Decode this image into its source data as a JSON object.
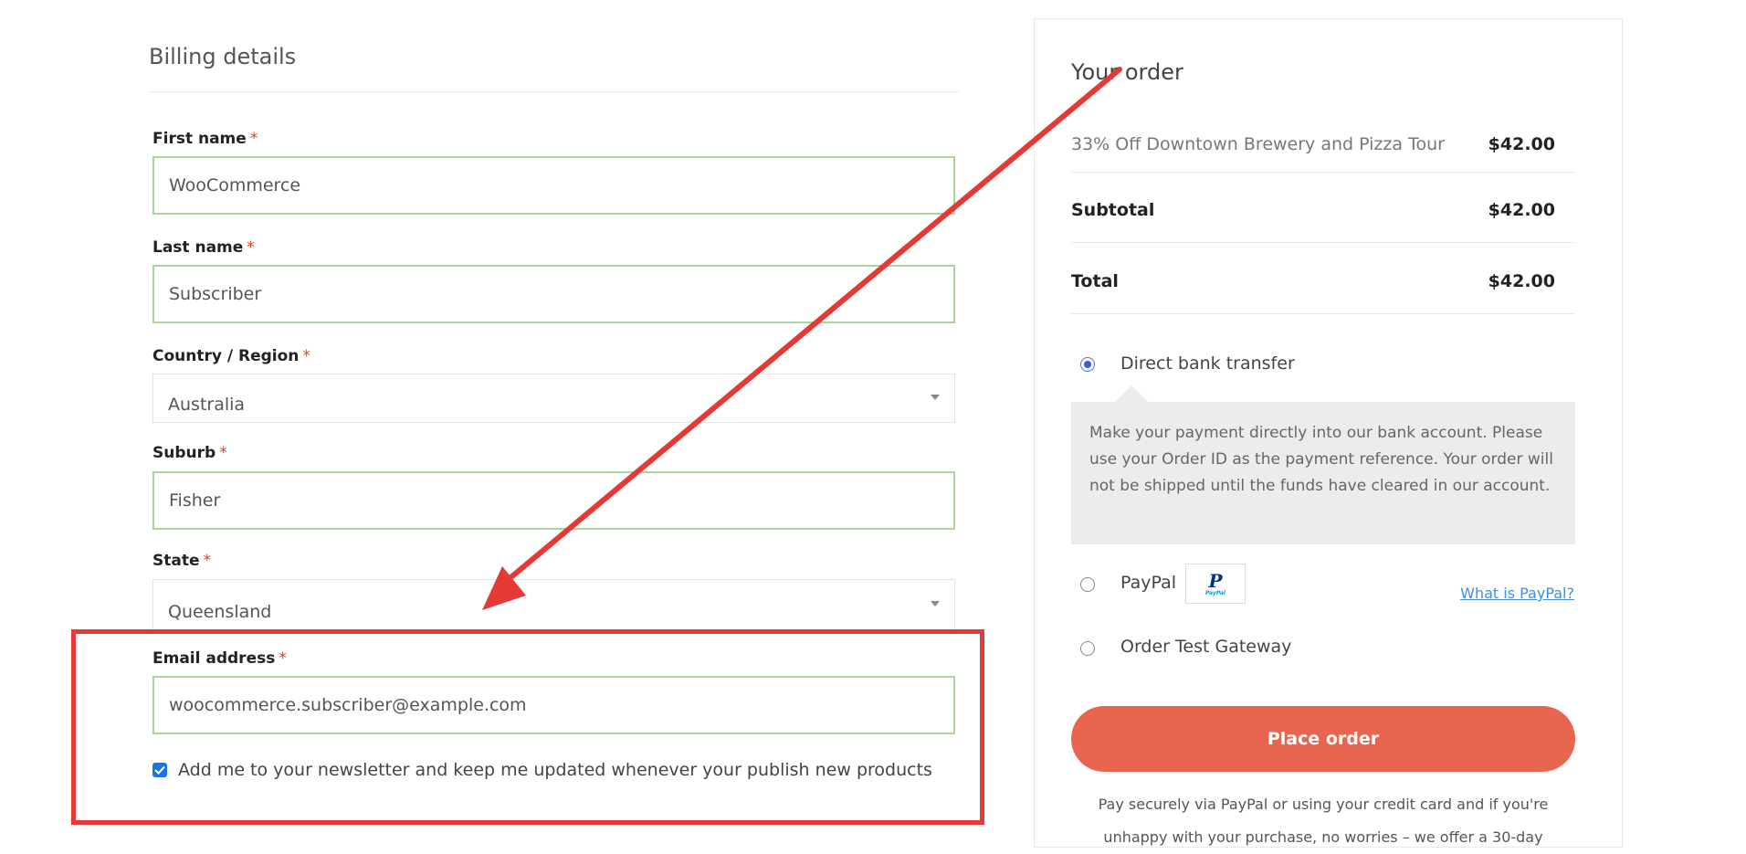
{
  "billing": {
    "title": "Billing details",
    "required_mark": "*",
    "fields": {
      "first_name": {
        "label": "First name",
        "value": "WooCommerce"
      },
      "last_name": {
        "label": "Last name",
        "value": "Subscriber"
      },
      "country": {
        "label": "Country / Region",
        "value": "Australia"
      },
      "suburb": {
        "label": "Suburb",
        "value": "Fisher"
      },
      "state": {
        "label": "State",
        "value": "Queensland"
      },
      "email": {
        "label": "Email address",
        "value": "woocommerce.subscriber@example.com"
      }
    },
    "newsletter_label": "Add me to your newsletter and keep me updated whenever your publish new products",
    "newsletter_checked": true
  },
  "order": {
    "title": "Your order",
    "items": [
      {
        "name": "33% Off Downtown Brewery and Pizza Tour",
        "price": "$42.00"
      }
    ],
    "subtotal": {
      "label": "Subtotal",
      "value": "$42.00"
    },
    "total": {
      "label": "Total",
      "value": "$42.00"
    },
    "payment_methods": {
      "bank": {
        "label": "Direct bank transfer",
        "selected": true,
        "description": "Make your payment directly into our bank account. Please use your Order ID as the payment reference. Your order will not be shipped until the funds have cleared in our account."
      },
      "paypal": {
        "label": "PayPal",
        "logo_text": "PayPal",
        "link": "What is PayPal?"
      },
      "test": {
        "label": "Order Test Gateway"
      }
    },
    "place_order": "Place order",
    "secure_note": "Pay securely via PayPal or using your credit card and if you're unhappy with your purchase, no worries – we offer a 30-day"
  },
  "colors": {
    "accent_button": "#e8664f",
    "annotation": "#e53935",
    "field_border_valid": "#a8d59b",
    "link": "#3f8fe0"
  }
}
